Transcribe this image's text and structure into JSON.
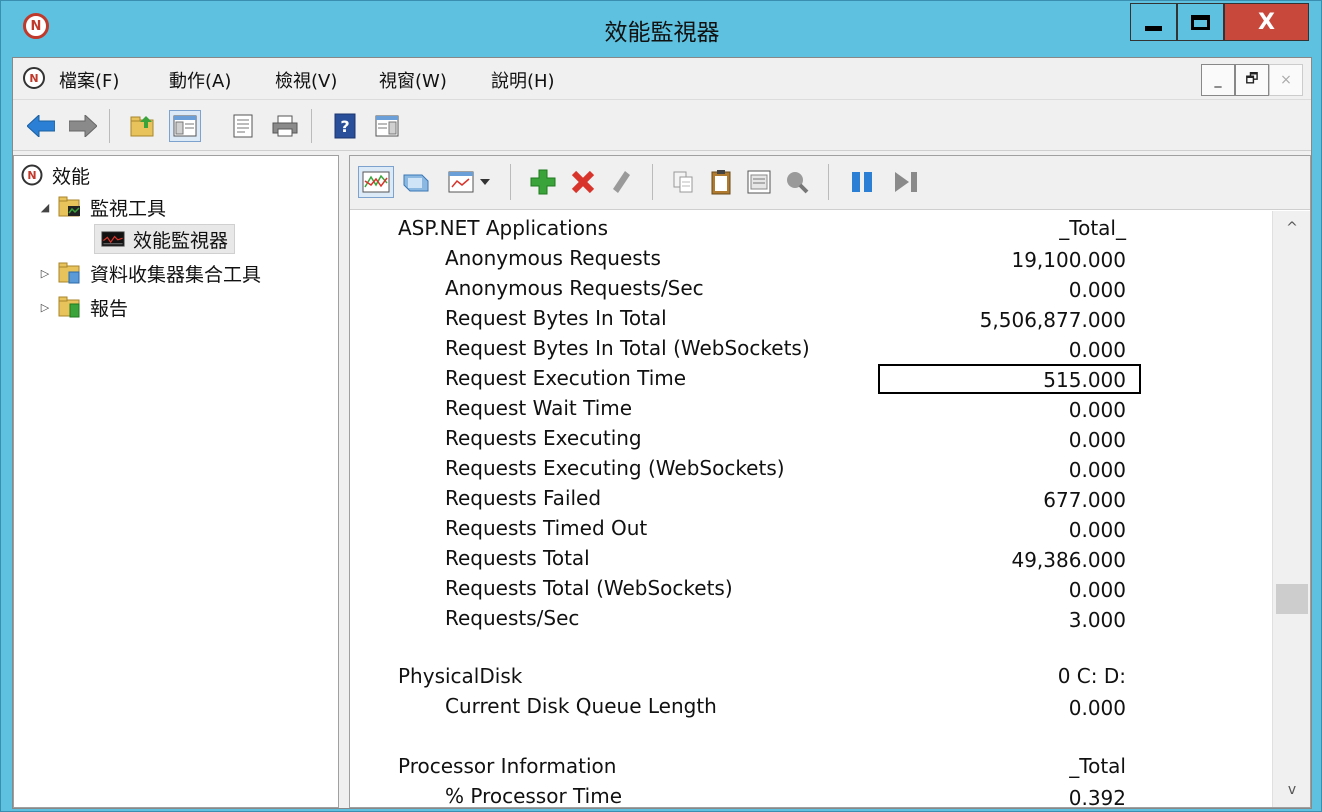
{
  "window": {
    "title": "效能監視器",
    "app_icon_glyph": "N",
    "close_glyph": "X"
  },
  "menubar": {
    "items": [
      "檔案(F)",
      "動作(A)",
      "檢視(V)",
      "視窗(W)",
      "說明(H)"
    ],
    "mdi": {
      "minimize": "_",
      "restore": "🗗",
      "close": "×"
    }
  },
  "tree": {
    "root": "效能",
    "monitoring_tools": "監視工具",
    "performance_monitor": "效能監視器",
    "data_collector_sets": "資料收集器集合工具",
    "reports": "報告",
    "expander_open": "◢",
    "expander_closed": "▷"
  },
  "report": {
    "objects": [
      {
        "name": "ASP.NET Applications",
        "instance": "_Total_",
        "counters": [
          {
            "name": "Anonymous Requests",
            "value": "19,100.000"
          },
          {
            "name": "Anonymous Requests/Sec",
            "value": "0.000"
          },
          {
            "name": "Request Bytes In Total",
            "value": "5,506,877.000"
          },
          {
            "name": "Request Bytes In Total (WebSockets)",
            "value": "0.000"
          },
          {
            "name": "Request Execution Time",
            "value": "515.000"
          },
          {
            "name": "Request Wait Time",
            "value": "0.000"
          },
          {
            "name": "Requests Executing",
            "value": "0.000"
          },
          {
            "name": "Requests Executing (WebSockets)",
            "value": "0.000"
          },
          {
            "name": "Requests Failed",
            "value": "677.000"
          },
          {
            "name": "Requests Timed Out",
            "value": "0.000"
          },
          {
            "name": "Requests Total",
            "value": "49,386.000"
          },
          {
            "name": "Requests Total (WebSockets)",
            "value": "0.000"
          },
          {
            "name": "Requests/Sec",
            "value": "3.000"
          }
        ]
      },
      {
        "name": "PhysicalDisk",
        "instance": "0 C: D:",
        "counters": [
          {
            "name": "Current Disk Queue Length",
            "value": "0.000"
          }
        ]
      },
      {
        "name": "Processor Information",
        "instance": "_Total",
        "counters": [
          {
            "name": "% Processor Time",
            "value": "0.392"
          }
        ]
      }
    ]
  },
  "scrollbar": {
    "up": "^",
    "down": "v"
  },
  "colors": {
    "titlebar": "#5ec1e0",
    "close_button": "#c9483c",
    "accent_blue": "#2b7fd4",
    "add_green": "#3aa43a",
    "delete_red": "#d9342b"
  },
  "icons": {
    "toolbar": [
      "back-arrow-icon",
      "forward-arrow-icon",
      "up-folder-icon",
      "show-hide-tree-icon",
      "properties-icon",
      "print-icon",
      "help-icon",
      "action-pane-icon"
    ],
    "perfmon_toolbar": [
      "line-graph-icon",
      "freeze-display-icon",
      "change-graph-type-icon",
      "add-counter-icon",
      "delete-counter-icon",
      "highlight-icon",
      "copy-properties-icon",
      "paste-counter-list-icon",
      "properties-icon",
      "zoom-icon",
      "pause-icon",
      "update-data-icon"
    ]
  }
}
